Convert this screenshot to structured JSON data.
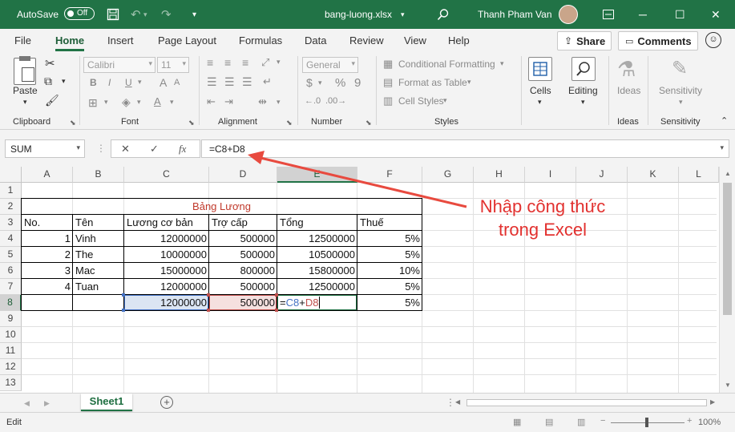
{
  "titlebar": {
    "autosave_label": "AutoSave",
    "autosave_state": "Off",
    "document_title": "bang-luong.xlsx",
    "user_name": "Thanh Pham Van"
  },
  "tabs": [
    "File",
    "Home",
    "Insert",
    "Page Layout",
    "Formulas",
    "Data",
    "Review",
    "View",
    "Help"
  ],
  "active_tab": "Home",
  "share_label": "Share",
  "comments_label": "Comments",
  "ribbon": {
    "clipboard": {
      "paste": "Paste",
      "label": "Clipboard"
    },
    "font": {
      "name": "Calibri",
      "size": "11",
      "bold": "B",
      "italic": "I",
      "underline": "U",
      "grow": "A",
      "shrink": "A",
      "color": "A",
      "label": "Font"
    },
    "alignment": {
      "label": "Alignment"
    },
    "number": {
      "format": "General",
      "currency": "$",
      "percent": "%",
      "comma": "9",
      "label": "Number"
    },
    "styles": {
      "conditional": "Conditional Formatting",
      "format_table": "Format as Table",
      "cell_styles": "Cell Styles",
      "label": "Styles"
    },
    "cells": {
      "button": "Cells"
    },
    "editing": {
      "button": "Editing"
    },
    "ideas": {
      "button": "Ideas",
      "label": "Ideas"
    },
    "sensitivity": {
      "button": "Sensitivity",
      "label": "Sensitivity"
    }
  },
  "formula_bar": {
    "name_box": "SUM",
    "fx": "fx",
    "formula": "=C8+D8"
  },
  "columns": [
    "A",
    "B",
    "C",
    "D",
    "E",
    "F",
    "G",
    "H",
    "I",
    "J",
    "K",
    "L"
  ],
  "rows": [
    "1",
    "2",
    "3",
    "4",
    "5",
    "6",
    "7",
    "8",
    "9",
    "10",
    "11",
    "12",
    "13"
  ],
  "sheet": {
    "title": "Bảng Lương",
    "headers": [
      "No.",
      "Tên",
      "Lương cơ bản",
      "Trợ cấp",
      "Tổng",
      "Thuế"
    ],
    "data": [
      [
        "1",
        "Vinh",
        "12000000",
        "500000",
        "12500000",
        "5%"
      ],
      [
        "2",
        "The",
        "10000000",
        "500000",
        "10500000",
        "5%"
      ],
      [
        "3",
        "Mac",
        "15000000",
        "800000",
        "15800000",
        "10%"
      ],
      [
        "4",
        "Tuan",
        "12000000",
        "500000",
        "12500000",
        "5%"
      ]
    ],
    "edit_row": {
      "c": "12000000",
      "d": "500000",
      "e_equals": "=",
      "e_ref1": "C8",
      "e_plus": "+",
      "e_ref2": "D8",
      "f": "5%"
    }
  },
  "sheet_tab": "Sheet1",
  "statusbar": {
    "mode": "Edit",
    "zoom": "100%"
  },
  "annotation": {
    "line1": "Nhập công thức",
    "line2": "trong Excel",
    "color": "#e2312f"
  },
  "colors": {
    "accent": "#217346",
    "ref_c": "#4472c4",
    "ref_d": "#c0504d"
  }
}
